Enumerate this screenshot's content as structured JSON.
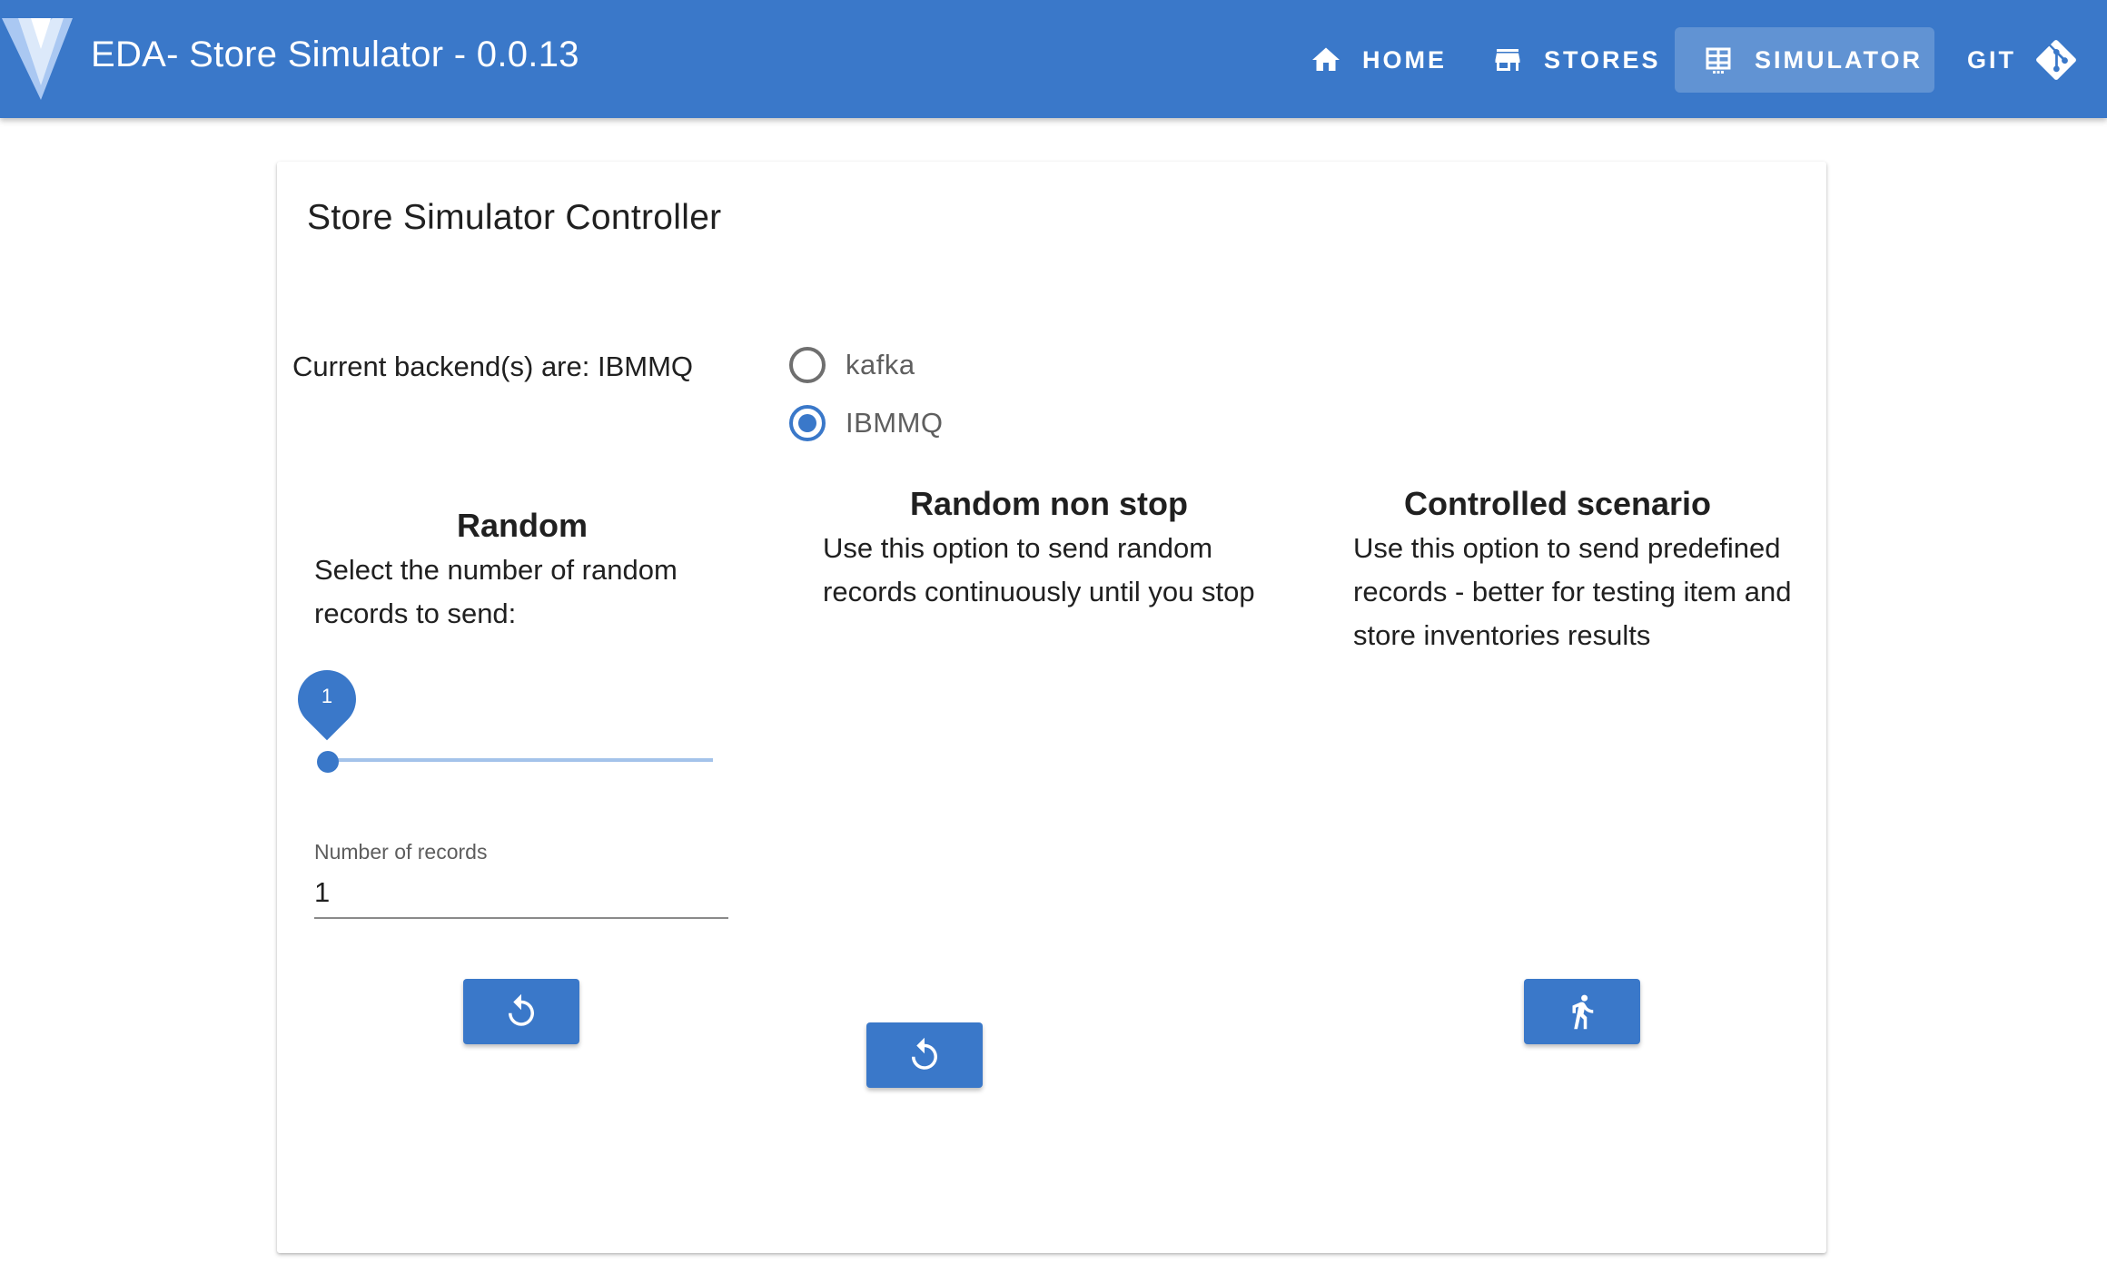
{
  "app": {
    "title": "EDA- Store Simulator - 0.0.13",
    "accent_color": "#3a78c9"
  },
  "nav": {
    "items": [
      {
        "label": "HOME",
        "icon": "home-icon",
        "active": false
      },
      {
        "label": "STORES",
        "icon": "store-icon",
        "active": false
      },
      {
        "label": "SIMULATOR",
        "icon": "table-icon",
        "active": true
      },
      {
        "label": "GIT",
        "icon": "git-icon",
        "active": false
      }
    ]
  },
  "card": {
    "title": "Store Simulator Controller",
    "backend_text": "Current backend(s) are: IBMMQ",
    "backend_options": [
      {
        "label": "kafka",
        "checked": false
      },
      {
        "label": "IBMMQ",
        "checked": true
      }
    ]
  },
  "random": {
    "title": "Random",
    "description": "Select the number of random records to send:",
    "slider_value": "1",
    "field_label": "Number of records",
    "field_value": "1",
    "button_icon": "restart-icon"
  },
  "random_non_stop": {
    "title": "Random non stop",
    "description": "Use this option to send random records continuously until you stop",
    "button_icon": "restart-icon"
  },
  "controlled": {
    "title": "Controlled scenario",
    "description": "Use this option to send predefined records - better for testing item and store inventories results",
    "button_icon": "run-icon"
  }
}
